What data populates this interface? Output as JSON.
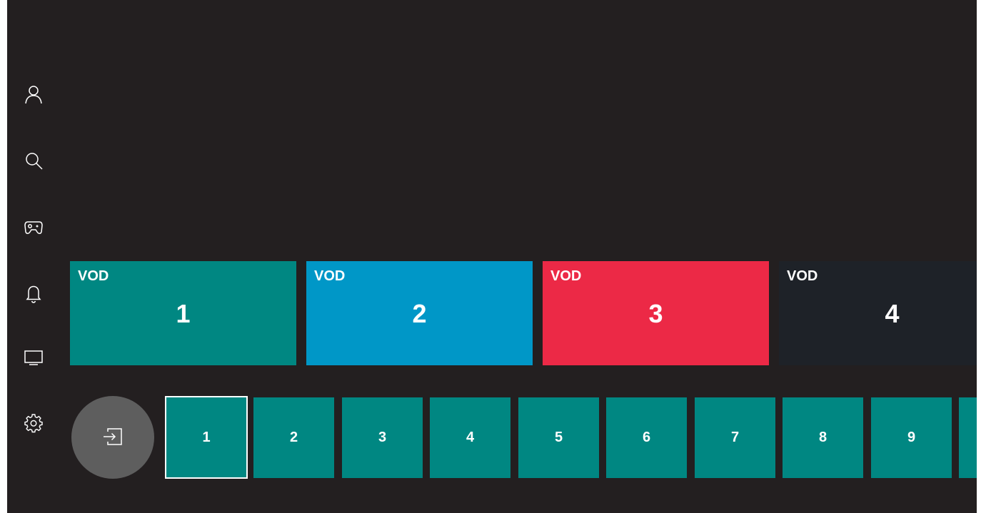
{
  "sidebar": {
    "items": [
      {
        "name": "profile",
        "icon": "person-icon"
      },
      {
        "name": "search",
        "icon": "search-icon"
      },
      {
        "name": "games",
        "icon": "gamepad-icon"
      },
      {
        "name": "notifications",
        "icon": "bell-icon"
      },
      {
        "name": "tv",
        "icon": "tv-icon"
      },
      {
        "name": "settings",
        "icon": "gear-icon"
      }
    ]
  },
  "vod": {
    "tiles": [
      {
        "label": "VOD",
        "number": "1",
        "color": "#008782"
      },
      {
        "label": "VOD",
        "number": "2",
        "color": "#0097c7"
      },
      {
        "label": "VOD",
        "number": "3",
        "color": "#ec2946"
      },
      {
        "label": "VOD",
        "number": "4",
        "color": "#1e2228"
      }
    ]
  },
  "input_button": {
    "icon": "input-source-icon"
  },
  "channels": {
    "tiles": [
      "1",
      "2",
      "3",
      "4",
      "5",
      "6",
      "7",
      "8",
      "9"
    ],
    "selected": "1",
    "color": "#008782"
  },
  "colors": {
    "background": "#231f20",
    "input_button": "#5e5e5e"
  }
}
